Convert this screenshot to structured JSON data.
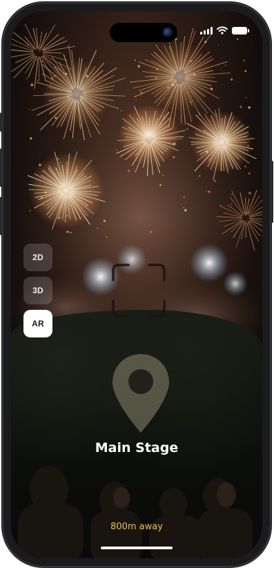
{
  "app": {
    "view_modes": [
      {
        "label": "2D",
        "active": false
      },
      {
        "label": "3D",
        "active": false
      },
      {
        "label": "AR",
        "active": true
      }
    ],
    "poi": {
      "name": "Main Stage",
      "distance": "800m away",
      "icon": "map-pin-icon"
    },
    "scene_icon": "ar-focus-reticle-icon"
  },
  "status_bar": {
    "icons": [
      "signal-icon",
      "wifi-icon",
      "battery-icon"
    ]
  },
  "colors": {
    "distance_text": "#e8c24a",
    "active_mode_bg": "#ffffff",
    "inactive_mode_bg": "rgba(255,255,255,0.16)"
  }
}
